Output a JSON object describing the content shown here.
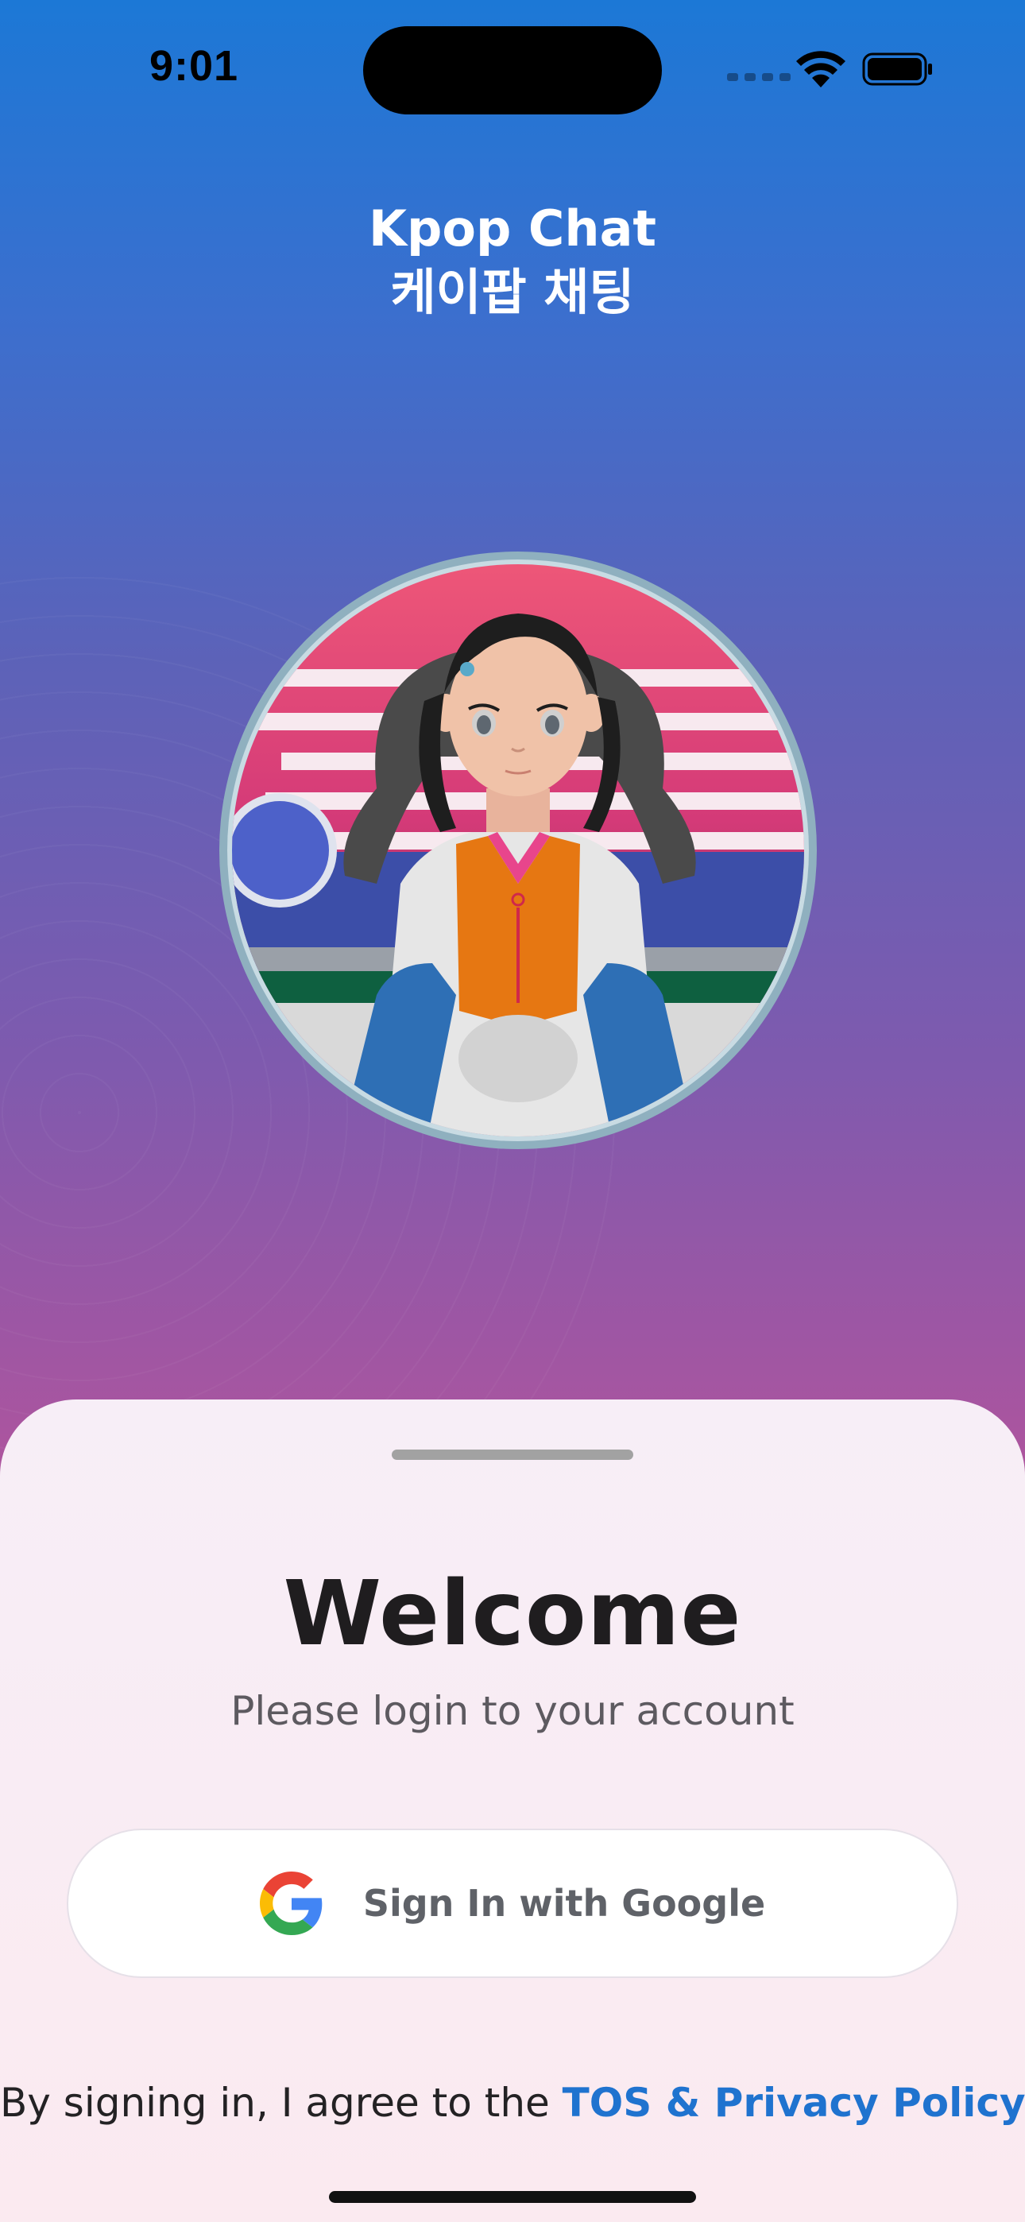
{
  "status_bar": {
    "time": "9:01",
    "icons": [
      "cellular-signal-icon",
      "wifi-icon",
      "battery-icon"
    ]
  },
  "app": {
    "title_en": "Kpop Chat",
    "title_ko": "케이팝 채팅"
  },
  "avatar": {
    "icon": "korean-girl-hanbok-avatar-icon"
  },
  "sheet": {
    "heading": "Welcome",
    "subtitle": "Please login to your account",
    "google_button_label": "Sign In with Google",
    "google_icon": "google-g-icon",
    "legal_prefix": "By signing in, I agree to the ",
    "legal_link": "TOS & Privacy Policy"
  },
  "colors": {
    "gradient_top": "#1c78d6",
    "gradient_bottom": "#b7559a",
    "link": "#1f73cf",
    "sheet_bg": "#f7eef7"
  }
}
